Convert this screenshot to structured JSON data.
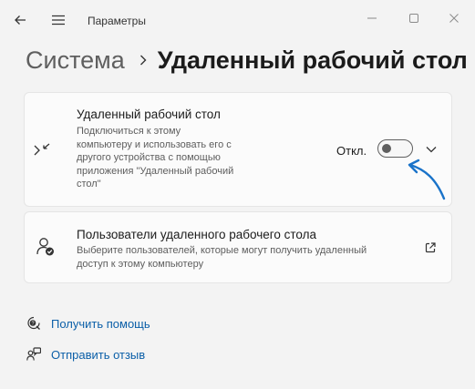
{
  "titlebar": {
    "back_icon": "arrow-left-icon",
    "menu_icon": "hamburger-icon",
    "title": "Параметры",
    "controls": [
      "minimize-icon",
      "maximize-icon",
      "close-icon"
    ]
  },
  "breadcrumb": {
    "parent": "Система",
    "current": "Удаленный рабочий стол"
  },
  "remote_desktop": {
    "icon": "remote-desktop-icon",
    "title": "Удаленный рабочий стол",
    "description_lines": [
      "Подключиться к этому",
      "компьютеру и использовать его с",
      "другого устройства с помощью",
      "приложения \"Удаленный рабочий",
      "стол\""
    ],
    "toggle_label": "Откл.",
    "toggle_on": false,
    "expand_icon": "chevron-down-icon"
  },
  "users": {
    "icon": "users-icon",
    "title": "Пользователи удаленного рабочего стола",
    "description_lines": [
      "Выберите пользователей, которые могут получить удаленный",
      "доступ к этому компьютеру"
    ],
    "open_icon": "external-link-icon"
  },
  "links": [
    {
      "icon": "help-icon",
      "label": "Получить помощь"
    },
    {
      "icon": "feedback-icon",
      "label": "Отправить отзыв"
    }
  ],
  "colors": {
    "background": "#f3f3f3",
    "card": "#fbfbfb",
    "link": "#0b5fa8",
    "annotation_arrow": "#1a73c9"
  }
}
